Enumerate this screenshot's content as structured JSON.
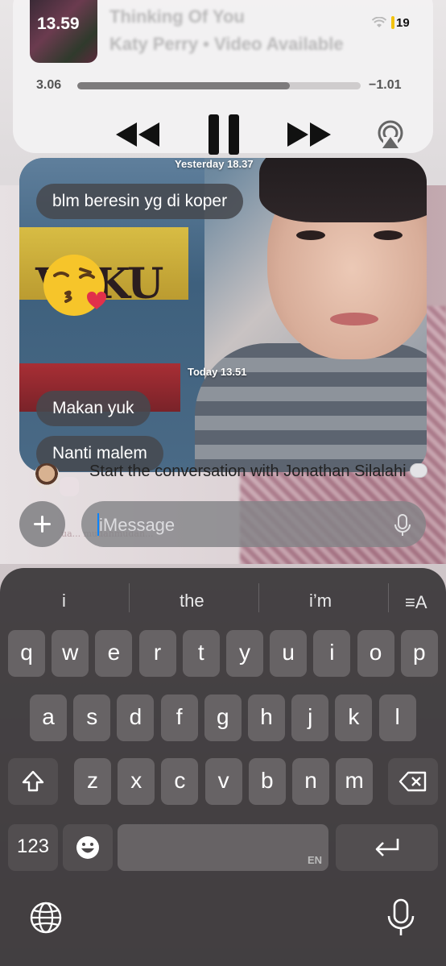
{
  "now_playing": {
    "art_time": "13.59",
    "title": "Thinking Of You",
    "artist": "Katy Perry • Video Available",
    "battery": "19",
    "elapsed": "3.06",
    "remaining": "−1.01",
    "progress": 0.75
  },
  "photo": {
    "sign_text": "VAKU",
    "timestamp_1": "Yesterday 18.37",
    "timestamp_2": "Today 13.51",
    "messages": [
      "blm beresin yg di koper",
      "Makan yuk",
      "Nanti malem"
    ],
    "emoji": "kiss-emoji"
  },
  "conversation": {
    "line": "Start the conversation with Jonathan Silalahi"
  },
  "input": {
    "placeholder": "iMessage",
    "bg_faint": "ua... mudahmudah..."
  },
  "keyboard": {
    "suggestions": [
      "i",
      "the",
      "i’m"
    ],
    "row1": [
      "q",
      "w",
      "e",
      "r",
      "t",
      "y",
      "u",
      "i",
      "o",
      "p"
    ],
    "row2": [
      "a",
      "s",
      "d",
      "f",
      "g",
      "h",
      "j",
      "k",
      "l"
    ],
    "row3": [
      "z",
      "x",
      "c",
      "v",
      "b",
      "n",
      "m"
    ],
    "numbers_key": "123",
    "space_lang": "EN",
    "format_label": "≡A"
  }
}
